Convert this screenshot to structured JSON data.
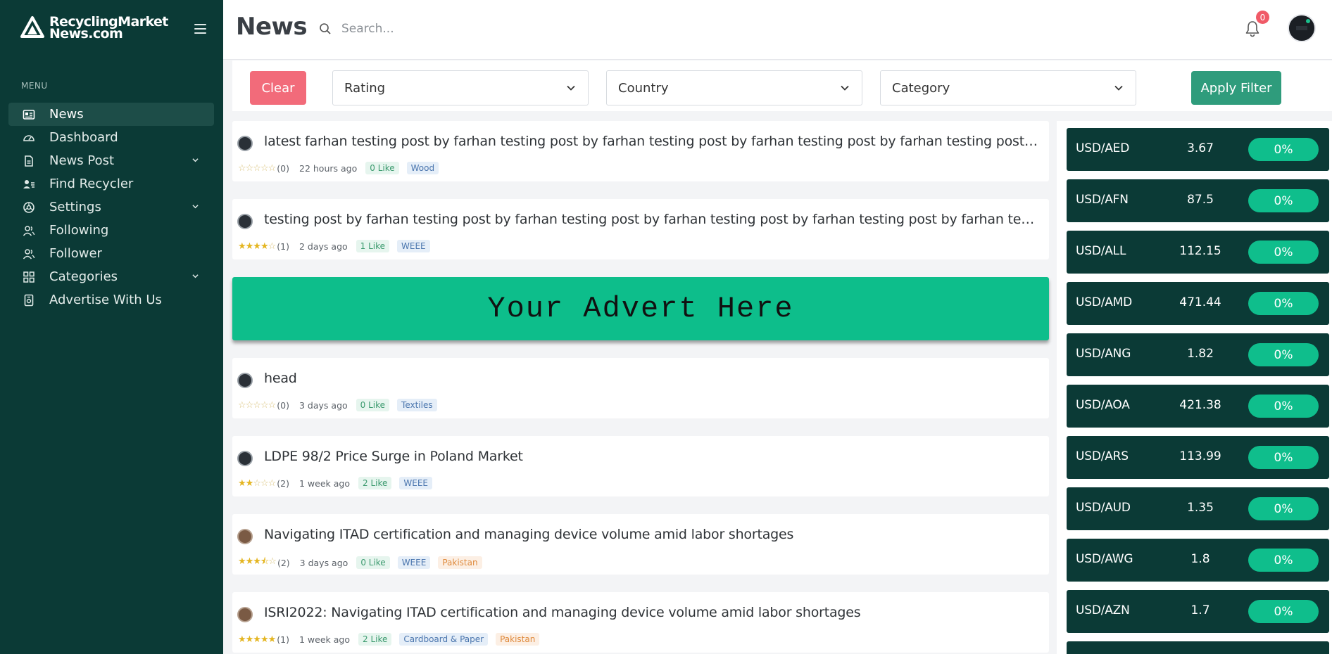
{
  "sidebar": {
    "brand_line1": "RecyclingMarket",
    "brand_line2": "News.com",
    "menu_title": "MENU",
    "items": [
      {
        "label": "News",
        "icon": "newspaper-icon"
      },
      {
        "label": "Dashboard",
        "icon": "gauge-icon"
      },
      {
        "label": "News Post",
        "icon": "file-icon"
      },
      {
        "label": "Find Recycler",
        "icon": "user-list-icon"
      },
      {
        "label": "Settings",
        "icon": "settings-icon"
      },
      {
        "label": "Following",
        "icon": "users-icon"
      },
      {
        "label": "Follower",
        "icon": "users-icon"
      },
      {
        "label": "Categories",
        "icon": "grid-icon"
      },
      {
        "label": "Advertise With Us",
        "icon": "advertise-icon"
      }
    ]
  },
  "header": {
    "title": "News",
    "search_placeholder": "Search...",
    "notification_count": "0"
  },
  "filters": {
    "clear_label": "Clear",
    "rating_label": "Rating",
    "country_label": "Country",
    "category_label": "Category",
    "apply_label": "Apply Filter"
  },
  "advert": {
    "text": "Your Advert Here"
  },
  "posts": [
    {
      "title": "latest farhan testing post by farhan testing post by farhan testing post by farhan testing post by farhan testing post by farhan testing post",
      "rating": "(0)",
      "stars": 0,
      "time": "22 hours ago",
      "likes": "0 Like",
      "category": "Wood",
      "country": ""
    },
    {
      "title": "testing post by farhan testing post by farhan testing post by farhan testing post by farhan testing post by farhan testing post by farhan",
      "rating": "(1)",
      "stars": 4,
      "time": "2 days ago",
      "likes": "1 Like",
      "category": "WEEE",
      "country": ""
    },
    {
      "title": "head",
      "rating": "(0)",
      "stars": 0,
      "time": "3 days ago",
      "likes": "0 Like",
      "category": "Textiles",
      "country": ""
    },
    {
      "title": "LDPE 98/2 Price Surge in Poland Market",
      "rating": "(2)",
      "stars": 2,
      "time": "1 week ago",
      "likes": "2 Like",
      "category": "WEEE",
      "country": ""
    },
    {
      "title": "Navigating ITAD certification and managing device volume amid labor shortages",
      "rating": "(2)",
      "stars": 3.5,
      "time": "3 days ago",
      "likes": "0 Like",
      "category": "WEEE",
      "country": "Pakistan"
    },
    {
      "title": "ISRI2022: Navigating ITAD certification and managing device volume amid labor shortages",
      "rating": "(1)",
      "stars": 5,
      "time": "1 week ago",
      "likes": "2 Like",
      "category": "Cardboard & Paper",
      "country": "Pakistan"
    }
  ],
  "rates": [
    {
      "pair": "USD/AED",
      "value": "3.67",
      "change": "0%"
    },
    {
      "pair": "USD/AFN",
      "value": "87.5",
      "change": "0%"
    },
    {
      "pair": "USD/ALL",
      "value": "112.15",
      "change": "0%"
    },
    {
      "pair": "USD/AMD",
      "value": "471.44",
      "change": "0%"
    },
    {
      "pair": "USD/ANG",
      "value": "1.82",
      "change": "0%"
    },
    {
      "pair": "USD/AOA",
      "value": "421.38",
      "change": "0%"
    },
    {
      "pair": "USD/ARS",
      "value": "113.99",
      "change": "0%"
    },
    {
      "pair": "USD/AUD",
      "value": "1.35",
      "change": "0%"
    },
    {
      "pair": "USD/AWG",
      "value": "1.8",
      "change": "0%"
    },
    {
      "pair": "USD/AZN",
      "value": "1.7",
      "change": "0%"
    }
  ],
  "colors": {
    "sidebar_bg": "#0b3a36",
    "accent_green": "#0dbe8b",
    "clear_red": "#f26b7a",
    "apply_green": "#2f9c7c"
  }
}
